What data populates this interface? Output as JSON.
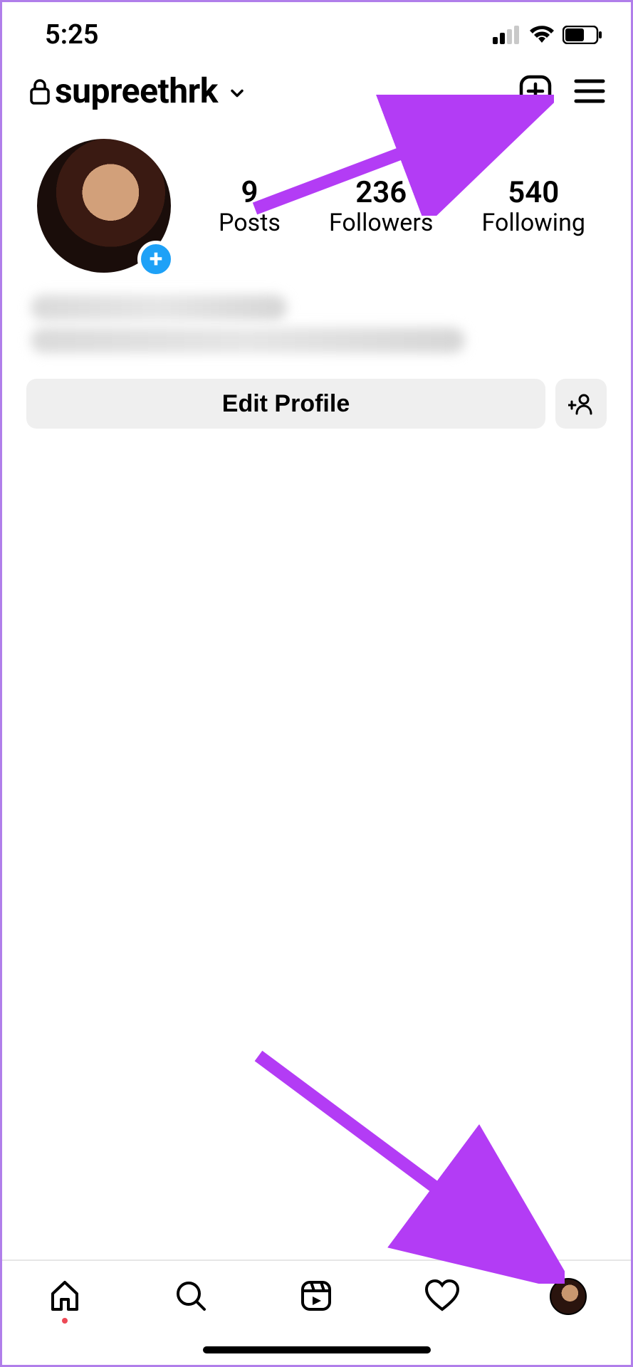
{
  "status": {
    "time": "5:25"
  },
  "header": {
    "username": "supreethrk"
  },
  "stats": {
    "posts": {
      "count": "9",
      "label": "Posts"
    },
    "followers": {
      "count": "236",
      "label": "Followers"
    },
    "following": {
      "count": "540",
      "label": "Following"
    }
  },
  "actions": {
    "edit_profile": "Edit Profile"
  },
  "annotation": {
    "arrow_color": "#b33cf5"
  }
}
